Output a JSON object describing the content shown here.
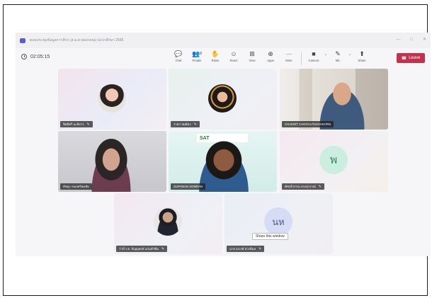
{
  "window": {
    "title": "ตอนประชุมข้อมูลการฟัวก (ส.ม.ส.ปดล่วคณ) ป่ะปาดีกษา 2566",
    "controls": [
      "—",
      "□",
      "✕"
    ]
  },
  "toolbar": {
    "timer": "02:05:15",
    "tools": [
      {
        "label": "Chat",
        "icon": "chat-icon",
        "glyph": "💬"
      },
      {
        "label": "People",
        "icon": "people-icon",
        "glyph": "👥",
        "badge": "8"
      },
      {
        "label": "Raise",
        "icon": "raise-hand-icon",
        "glyph": "✋"
      },
      {
        "label": "React",
        "icon": "react-icon",
        "glyph": "☺"
      },
      {
        "label": "View",
        "icon": "view-icon",
        "glyph": "⊞"
      },
      {
        "label": "Apps",
        "icon": "apps-icon",
        "glyph": "⊕"
      },
      {
        "label": "More",
        "icon": "more-icon",
        "glyph": "···"
      }
    ],
    "media": [
      {
        "label": "Camera",
        "icon": "camera-off-icon",
        "glyph": "■"
      },
      {
        "label": "Mic",
        "icon": "mic-off-icon",
        "glyph": "✎"
      },
      {
        "label": "Share",
        "icon": "share-icon",
        "glyph": "⬆"
      }
    ],
    "leave_label": "Leave",
    "leave_color": "#c4314b"
  },
  "participants": [
    {
      "name": "จิตติศรี นะจิยาว",
      "muted": true,
      "type": "photo"
    },
    {
      "name": "ราคา สมมิตร",
      "muted": true,
      "type": "photo"
    },
    {
      "name": "CHAKRIT CHOOVUTHAYAKORN",
      "muted": false,
      "type": "video"
    },
    {
      "name": "ทัชญา ทองศรีพมชัย",
      "muted": false,
      "type": "video"
    },
    {
      "name": "SUPAWAN SOMRAN",
      "muted": false,
      "type": "video",
      "banner": "SAT"
    },
    {
      "name": "พัชรลีวรรณ ทรงสุวรรณ์",
      "muted": true,
      "type": "initials",
      "initials": "พ"
    },
    {
      "name": "ว่าที่ ร.ต. ปัญญพงษ์ แถนคำพิน",
      "muted": true,
      "type": "photo"
    },
    {
      "name": "นาย ณรงค์ ห่วงดีมล",
      "muted": true,
      "type": "initials",
      "initials": "นห"
    }
  ],
  "tooltip": "Share this window"
}
